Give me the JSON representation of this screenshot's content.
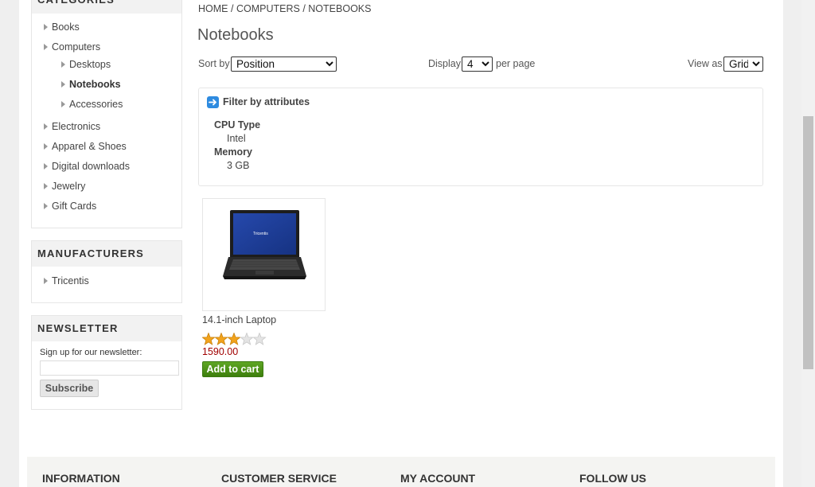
{
  "sidebar": {
    "categories": {
      "title": "CATEGORIES",
      "items": [
        {
          "label": "Books"
        },
        {
          "label": "Computers"
        },
        {
          "label": "Desktops"
        },
        {
          "label": "Notebooks"
        },
        {
          "label": "Accessories"
        },
        {
          "label": "Electronics"
        },
        {
          "label": "Apparel & Shoes"
        },
        {
          "label": "Digital downloads"
        },
        {
          "label": "Jewelry"
        },
        {
          "label": "Gift Cards"
        }
      ]
    },
    "manufacturers": {
      "title": "MANUFACTURERS",
      "items": [
        {
          "label": "Tricentis"
        }
      ]
    },
    "newsletter": {
      "title": "NEWSLETTER",
      "label": "Sign up for our newsletter:",
      "input_value": "",
      "subscribe_label": "Subscribe"
    }
  },
  "breadcrumb": {
    "home": "HOME",
    "sep": "/",
    "computers": "COMPUTERS",
    "current": "NOTEBOOKS"
  },
  "main": {
    "title": "Notebooks",
    "sort": {
      "label": "Sort by",
      "value": "Position"
    },
    "display": {
      "label": "Display",
      "value": "4",
      "suffix": "per page"
    },
    "view": {
      "label": "View as",
      "value": "Grid"
    }
  },
  "filter": {
    "title": "Filter by attributes",
    "attributes": [
      {
        "name": "CPU Type",
        "value": "Intel"
      },
      {
        "name": "Memory",
        "value": "3 GB"
      }
    ]
  },
  "product": {
    "name": "14.1-inch Laptop",
    "rating": 3,
    "rating_max": 5,
    "price": "1590.00",
    "add_to_cart_label": "Add to cart",
    "screen_brand": "Tricentis"
  },
  "footer": {
    "columns": [
      "INFORMATION",
      "CUSTOMER SERVICE",
      "MY ACCOUNT",
      "FOLLOW US"
    ]
  },
  "colors": {
    "accent_green": "#4a9216",
    "price_red": "#a00000",
    "arrow_blue": "#2e8be0",
    "star_gold": "#f2a31c"
  }
}
